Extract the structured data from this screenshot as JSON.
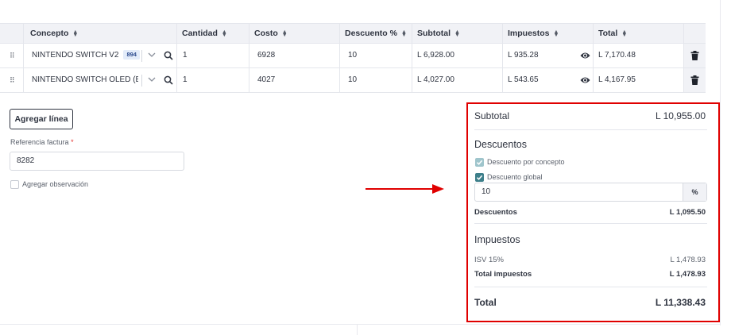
{
  "table": {
    "headers": [
      "Concepto",
      "Cantidad",
      "Costo",
      "Descuento %",
      "Subtotal",
      "Impuestos",
      "Total"
    ],
    "rows": [
      {
        "concepto": "NINTENDO SWITCH V2",
        "badge": "894",
        "cantidad": "1",
        "costo": "6928",
        "descuento": "10",
        "subtotal": "L 6,928.00",
        "impuestos": "L 935.28",
        "total": "L 7,170.48"
      },
      {
        "concepto": "NINTENDO SWITCH OLED (BLAN",
        "badge": "",
        "cantidad": "1",
        "costo": "4027",
        "descuento": "10",
        "subtotal": "L 4,027.00",
        "impuestos": "L 543.65",
        "total": "L 4,167.95"
      }
    ]
  },
  "form": {
    "add_line_label": "Agregar línea",
    "reference_label": "Referencia factura",
    "reference_required": "*",
    "reference_value": "8282",
    "observation_label": "Agregar observación"
  },
  "summary": {
    "subtotal_label": "Subtotal",
    "subtotal_value": "L 10,955.00",
    "discounts_title": "Descuentos",
    "discount_by_concept_label": "Descuento por concepto",
    "discount_global_label": "Descuento global",
    "discount_global_value": "10",
    "discount_unit": "%",
    "discounts_label": "Descuentos",
    "discounts_value": "L 1,095.50",
    "taxes_title": "Impuestos",
    "isv_label": "ISV 15%",
    "isv_value": "L 1,478.93",
    "total_taxes_label": "Total impuestos",
    "total_taxes_value": "L 1,478.93",
    "total_label": "Total",
    "total_value": "L 11,338.43"
  },
  "colors": {
    "highlight_border": "#e00000",
    "checkbox_checked": "#3d7f8a",
    "checkbox_disabled": "#9fc5cc",
    "arrow": "#e00000"
  },
  "icons": {
    "drag": "drag-handle-icon",
    "sort": "sort-icon",
    "chevron": "chevron-down-icon",
    "search": "search-icon",
    "eye": "eye-icon",
    "trash": "trash-icon",
    "check": "check-icon",
    "percent": "percent-icon"
  }
}
